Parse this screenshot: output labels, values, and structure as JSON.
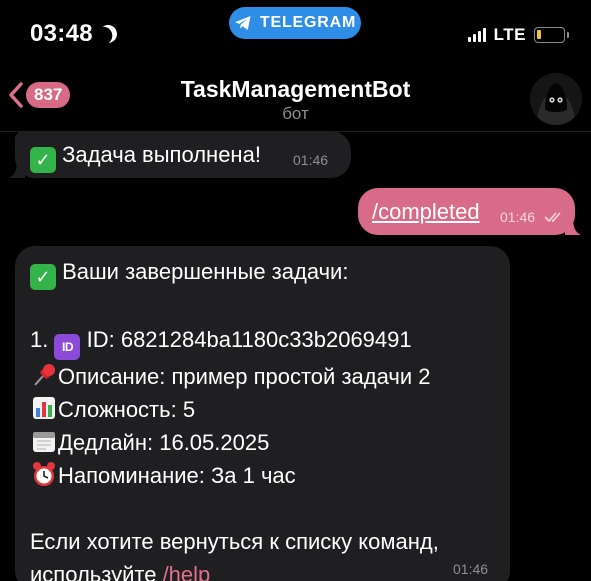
{
  "status_bar": {
    "time": "03:48",
    "app_pill": "TELEGRAM",
    "network": "LTE"
  },
  "header": {
    "back_badge": "837",
    "title": "TaskManagementBot",
    "subtitle": "бот"
  },
  "messages": [
    {
      "direction": "in",
      "text": "Задача выполнена!",
      "time": "01:46"
    },
    {
      "direction": "out",
      "text": "/completed",
      "time": "01:46"
    },
    {
      "direction": "in",
      "heading": "Ваши завершенные задачи:",
      "item_number": "1.",
      "id_line": "ID: 6821284ba1180c33b2069491",
      "description": "Описание: пример простой задачи 2",
      "complexity": "Сложность: 5",
      "deadline": "Дедлайн: 16.05.2025",
      "reminder": "Напоминание: За 1 час",
      "footer_line1": "Если хотите вернуться к списку команд,",
      "footer_line2": "используйте ",
      "help_command": "/help",
      "time": "01:46"
    }
  ],
  "colors": {
    "background": "#000000",
    "incoming_bubble": "#1f1f21",
    "outgoing_bubble": "#d76b88",
    "telegram_pill": "#2e8de6",
    "accent": "#d86a86",
    "battery": "#f2c230"
  },
  "icons": [
    "moon-icon",
    "telegram-plane-icon",
    "signal-icon",
    "battery-icon",
    "chevron-left-icon",
    "check-mark-emoji",
    "id-emoji",
    "pushpin-emoji",
    "bar-chart-emoji",
    "calendar-emoji",
    "alarm-clock-emoji",
    "double-check-icon"
  ]
}
